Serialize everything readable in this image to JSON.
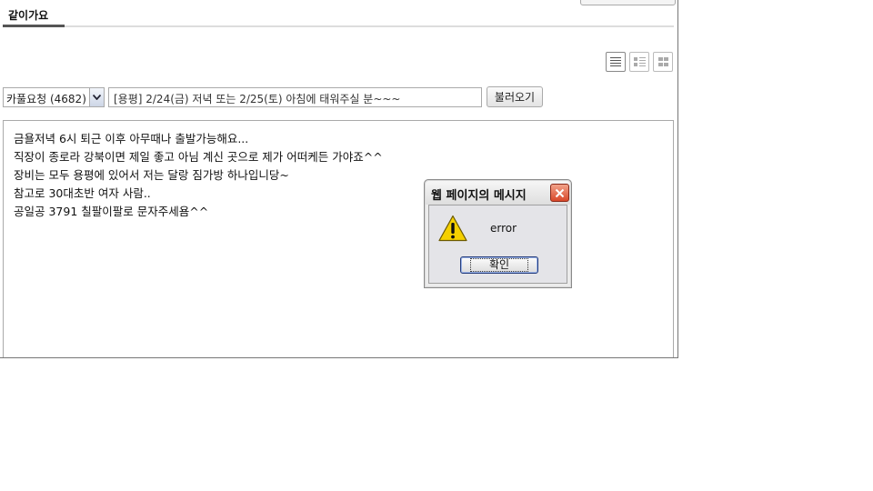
{
  "tab": {
    "active_label": "같이가요"
  },
  "view_buttons": [
    "list-view-icon",
    "detail-view-icon",
    "grid-view-icon"
  ],
  "category_select": {
    "value": "카풀요청 (4682)"
  },
  "title_input": {
    "value": "[용평] 2/24(금) 저녁 또는 2/25(토) 아침에 태워주실 분~~~"
  },
  "load_button": {
    "label": "불러오기"
  },
  "content": {
    "lines": [
      "금욜저녁 6시 퇴근 이후 아무때나 출발가능해요...",
      "직장이 종로라 강북이면 제일 좋고 아님 계신 곳으로 제가 어떠케든 가야죠^^",
      "장비는 모두 용평에 있어서 저는 달랑 짐가방 하나입니당~",
      "참고로 30대초반 여자 사람..",
      "공일공 3791 칠팔이팔로 문자주세욤^^"
    ]
  },
  "dialog": {
    "title": "웹 페이지의 메시지",
    "message": "error",
    "ok_label": "확인",
    "icon": "warning-icon"
  },
  "colors": {
    "close_button": "#d9482a",
    "warning_yellow": "#f5d000",
    "tab_underline": "#555555"
  }
}
